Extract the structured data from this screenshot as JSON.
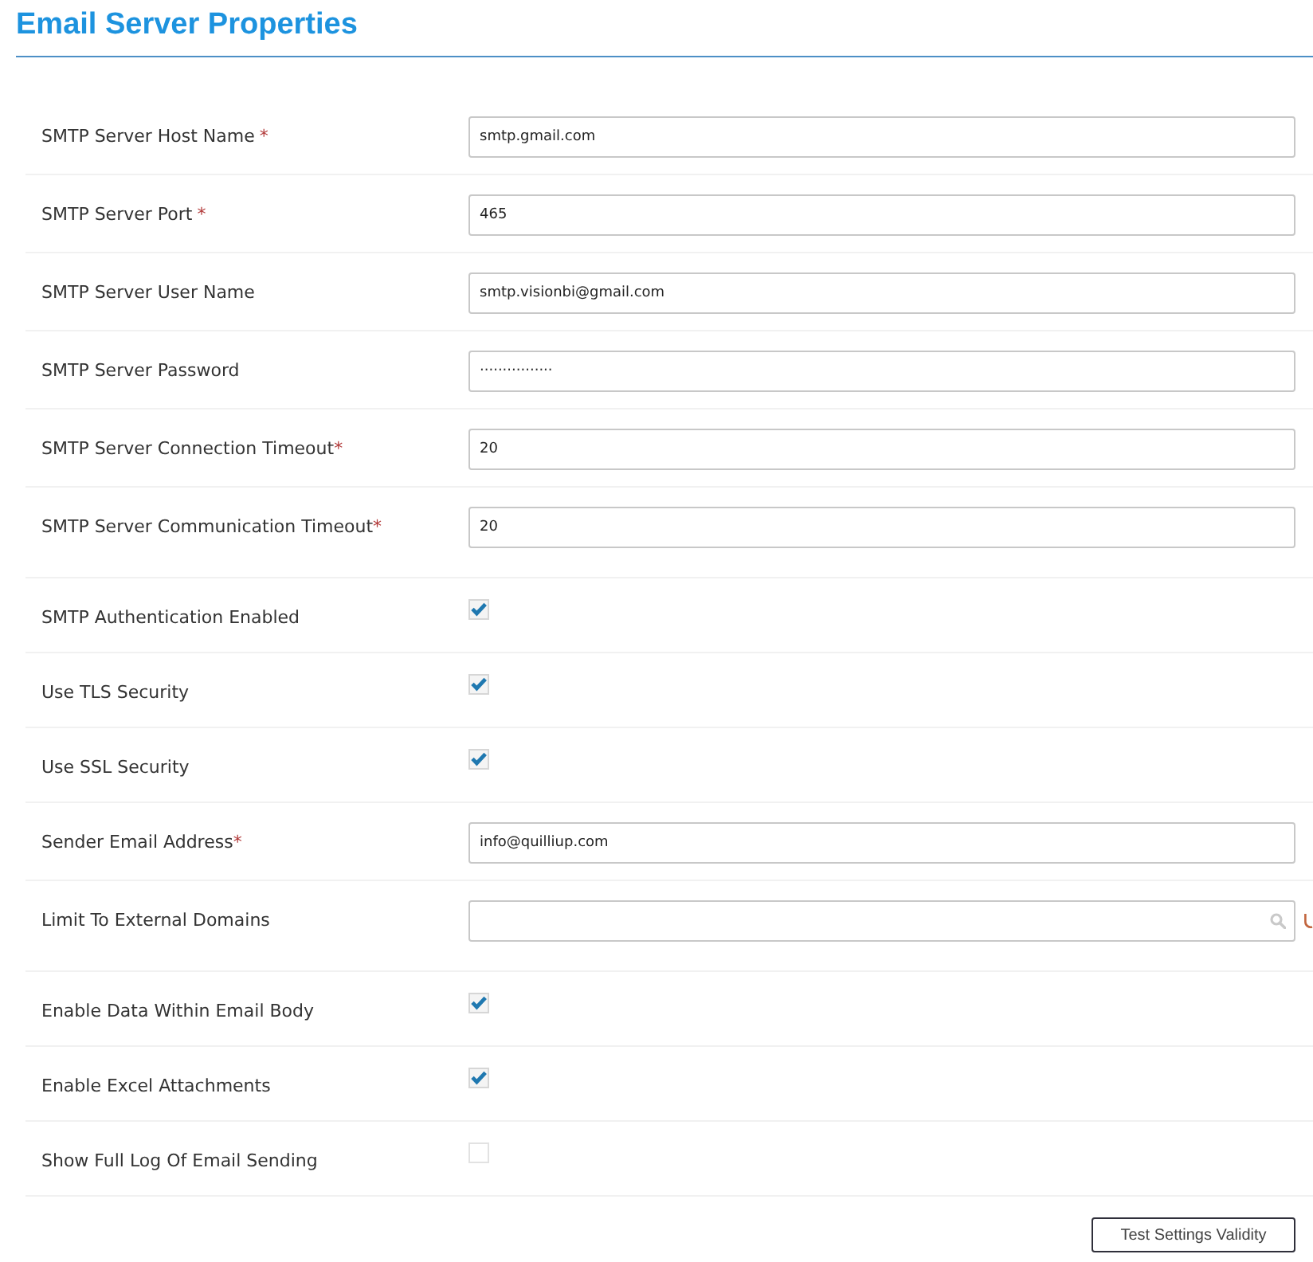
{
  "title": "Email Server Properties",
  "fields": [
    {
      "kind": "text",
      "label": "SMTP Server Host Name",
      "required_mark": "*",
      "mark_spaced": true,
      "value": "smtp.gmail.com"
    },
    {
      "kind": "text",
      "label": "SMTP Server Port",
      "required_mark": "*",
      "mark_spaced": true,
      "value": "465"
    },
    {
      "kind": "text",
      "label": "SMTP Server User Name",
      "value": "smtp.visionbi@gmail.com"
    },
    {
      "kind": "text",
      "label": "SMTP Server Password",
      "value": "················"
    },
    {
      "kind": "text",
      "label": "SMTP Server Connection Timeout",
      "required_mark": "*",
      "mark_spaced": false,
      "value": "20"
    },
    {
      "kind": "text",
      "label": "SMTP Server Communication Timeout",
      "required_mark": "*",
      "mark_spaced": false,
      "value": "20"
    },
    {
      "kind": "checkbox",
      "label": "SMTP Authentication Enabled",
      "checked": true
    },
    {
      "kind": "checkbox",
      "label": "Use TLS Security",
      "checked": true
    },
    {
      "kind": "checkbox",
      "label": "Use SSL Security",
      "checked": true
    },
    {
      "kind": "text",
      "label": "Sender Email Address",
      "required_mark": "*",
      "mark_spaced": false,
      "value": "info@quilliup.com"
    },
    {
      "kind": "search",
      "label": "Limit To External Domains"
    },
    {
      "kind": "checkbox",
      "label": "Enable Data Within Email Body",
      "checked": true
    },
    {
      "kind": "checkbox",
      "label": "Enable Excel Attachments",
      "checked": true
    },
    {
      "kind": "checkbox",
      "label": "Show Full Log Of Email Sending",
      "checked": false
    }
  ],
  "button": "Test Settings Validity"
}
